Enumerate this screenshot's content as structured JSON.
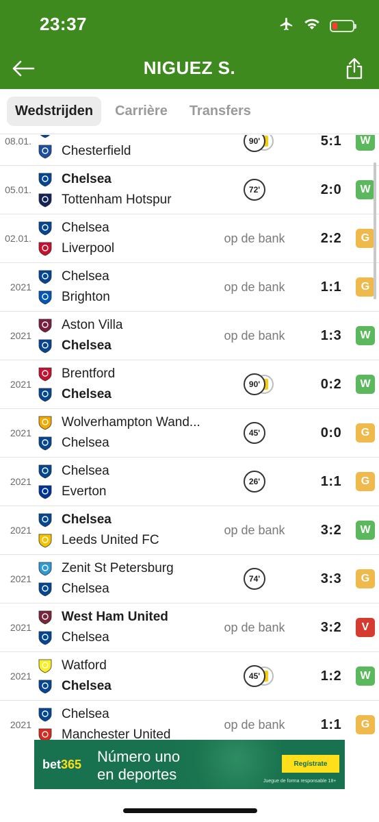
{
  "status_bar": {
    "time": "23:37"
  },
  "header": {
    "title": "NIGUEZ S."
  },
  "tabs": [
    {
      "label": "Wedstrijden",
      "active": true
    },
    {
      "label": "Carrière",
      "active": false
    },
    {
      "label": "Transfers",
      "active": false
    }
  ],
  "matches": [
    {
      "date": "08.01.",
      "home": "Chelsea",
      "away": "Chesterfield",
      "home_bold": true,
      "away_bold": false,
      "minutes": "90'",
      "yellow_card": true,
      "bench": "",
      "score": "5:1",
      "result": "W"
    },
    {
      "date": "05.01.",
      "home": "Chelsea",
      "away": "Tottenham Hotspur",
      "home_bold": true,
      "away_bold": false,
      "minutes": "72'",
      "yellow_card": false,
      "bench": "",
      "score": "2:0",
      "result": "W"
    },
    {
      "date": "02.01.",
      "home": "Chelsea",
      "away": "Liverpool",
      "home_bold": false,
      "away_bold": false,
      "minutes": "",
      "yellow_card": false,
      "bench": "op de bank",
      "score": "2:2",
      "result": "G"
    },
    {
      "date": "2021",
      "home": "Chelsea",
      "away": "Brighton",
      "home_bold": false,
      "away_bold": false,
      "minutes": "",
      "yellow_card": false,
      "bench": "op de bank",
      "score": "1:1",
      "result": "G"
    },
    {
      "date": "2021",
      "home": "Aston Villa",
      "away": "Chelsea",
      "home_bold": false,
      "away_bold": true,
      "minutes": "",
      "yellow_card": false,
      "bench": "op de bank",
      "score": "1:3",
      "result": "W"
    },
    {
      "date": "2021",
      "home": "Brentford",
      "away": "Chelsea",
      "home_bold": false,
      "away_bold": true,
      "minutes": "90'",
      "yellow_card": true,
      "bench": "",
      "score": "0:2",
      "result": "W"
    },
    {
      "date": "2021",
      "home": "Wolverhampton Wand...",
      "away": "Chelsea",
      "home_bold": false,
      "away_bold": false,
      "minutes": "45'",
      "yellow_card": false,
      "bench": "",
      "score": "0:0",
      "result": "G"
    },
    {
      "date": "2021",
      "home": "Chelsea",
      "away": "Everton",
      "home_bold": false,
      "away_bold": false,
      "minutes": "26'",
      "yellow_card": false,
      "bench": "",
      "score": "1:1",
      "result": "G"
    },
    {
      "date": "2021",
      "home": "Chelsea",
      "away": "Leeds United FC",
      "home_bold": true,
      "away_bold": false,
      "minutes": "",
      "yellow_card": false,
      "bench": "op de bank",
      "score": "3:2",
      "result": "W"
    },
    {
      "date": "2021",
      "home": "Zenit St Petersburg",
      "away": "Chelsea",
      "home_bold": false,
      "away_bold": false,
      "minutes": "74'",
      "yellow_card": false,
      "bench": "",
      "score": "3:3",
      "result": "G"
    },
    {
      "date": "2021",
      "home": "West Ham United",
      "away": "Chelsea",
      "home_bold": true,
      "away_bold": false,
      "minutes": "",
      "yellow_card": false,
      "bench": "op de bank",
      "score": "3:2",
      "result": "V"
    },
    {
      "date": "2021",
      "home": "Watford",
      "away": "Chelsea",
      "home_bold": false,
      "away_bold": true,
      "minutes": "45'",
      "yellow_card": true,
      "bench": "",
      "score": "1:2",
      "result": "W"
    },
    {
      "date": "2021",
      "home": "Chelsea",
      "away": "Manchester United",
      "home_bold": false,
      "away_bold": false,
      "minutes": "",
      "yellow_card": false,
      "bench": "op de bank",
      "score": "1:1",
      "result": "G"
    }
  ],
  "result_colors": {
    "W": "#5cb85c",
    "G": "#f0b94c",
    "V": "#d63b2f"
  },
  "crest_colors": {
    "Chelsea": "#034694",
    "Chesterfield": "#1d4fa1",
    "Tottenham Hotspur": "#132257",
    "Liverpool": "#c8102e",
    "Brighton": "#0057b8",
    "Aston Villa": "#7a1e3f",
    "Brentford": "#c8102e",
    "Wolverhampton Wand...": "#f2a900",
    "Everton": "#003399",
    "Leeds United FC": "#f3c300",
    "Zenit St Petersburg": "#2c9ad6",
    "West Ham United": "#7a263a",
    "Watford": "#fbee23",
    "Manchester United": "#da291c"
  },
  "ad": {
    "brand_main": "bet",
    "brand_accent": "365",
    "headline_line1": "Número uno",
    "headline_line2": "en deportes",
    "cta": "Regístrate",
    "disclaimer": "Juegue de forma responsable  18+"
  },
  "theme": {
    "header_bg": "#3f8a1f",
    "ad_bg": "#18724f",
    "ad_accent": "#ffdf1b"
  },
  "icons": {
    "back": "arrow-left-icon",
    "share": "share-icon",
    "airplane": "airplane-icon",
    "wifi": "wifi-icon",
    "battery": "battery-icon"
  }
}
